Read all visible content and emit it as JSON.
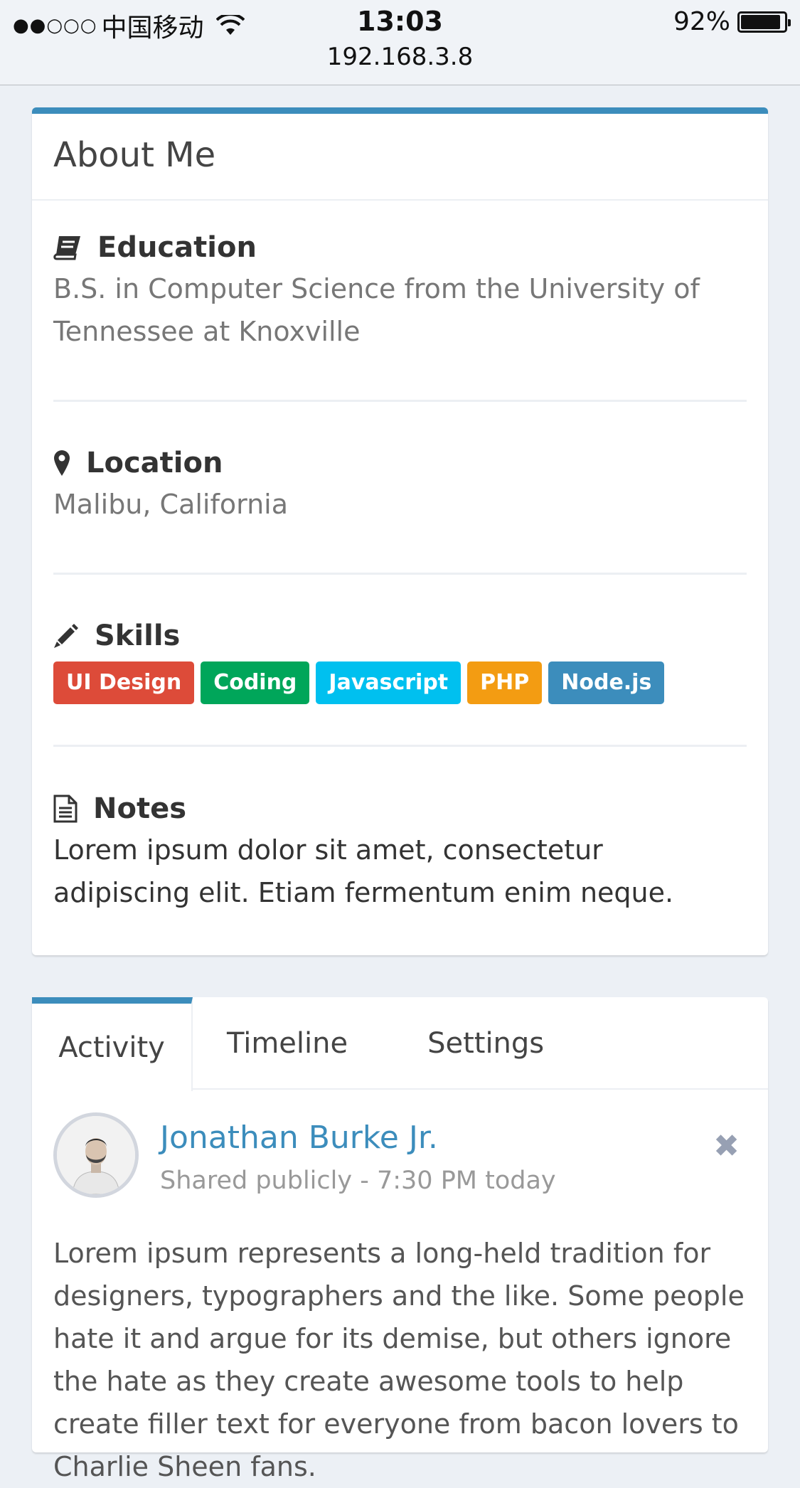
{
  "status_bar": {
    "signal": "●●○○○",
    "carrier": "中国移动",
    "time": "13:03",
    "url": "192.168.3.8",
    "battery": "92%",
    "battery_level": 0.92
  },
  "about": {
    "title": "About Me",
    "education": {
      "heading": "Education",
      "icon": "book-icon",
      "text": "B.S. in Computer Science from the University of Tennessee at Knoxville"
    },
    "location": {
      "heading": "Location",
      "icon": "map-marker-icon",
      "text": "Malibu, California"
    },
    "skills": {
      "heading": "Skills",
      "icon": "pencil-icon",
      "tags": [
        {
          "label": "UI Design",
          "color": "#dd4b39"
        },
        {
          "label": "Coding",
          "color": "#00a65a"
        },
        {
          "label": "Javascript",
          "color": "#00c0ef"
        },
        {
          "label": "PHP",
          "color": "#f39c12"
        },
        {
          "label": "Node.js",
          "color": "#3c8dbc"
        }
      ]
    },
    "notes": {
      "heading": "Notes",
      "icon": "file-text-icon",
      "text": "Lorem ipsum dolor sit amet, consectetur adipiscing elit. Etiam fermentum enim neque."
    }
  },
  "activity": {
    "tabs": [
      {
        "label": "Activity",
        "active": true
      },
      {
        "label": "Timeline",
        "active": false
      },
      {
        "label": "Settings",
        "active": false
      }
    ],
    "post": {
      "user": "Jonathan Burke Jr.",
      "meta": "Shared publicly - 7:30 PM today",
      "close_icon": "close-icon",
      "body": "Lorem ipsum represents a long-held tradition for designers, typographers and the like. Some people hate it and argue for its demise, but others ignore the hate as they create awesome tools to help create filler text for everyone from bacon lovers to Charlie Sheen fans."
    }
  },
  "colors": {
    "primary": "#3c8dbc",
    "background": "#ecf0f5"
  }
}
